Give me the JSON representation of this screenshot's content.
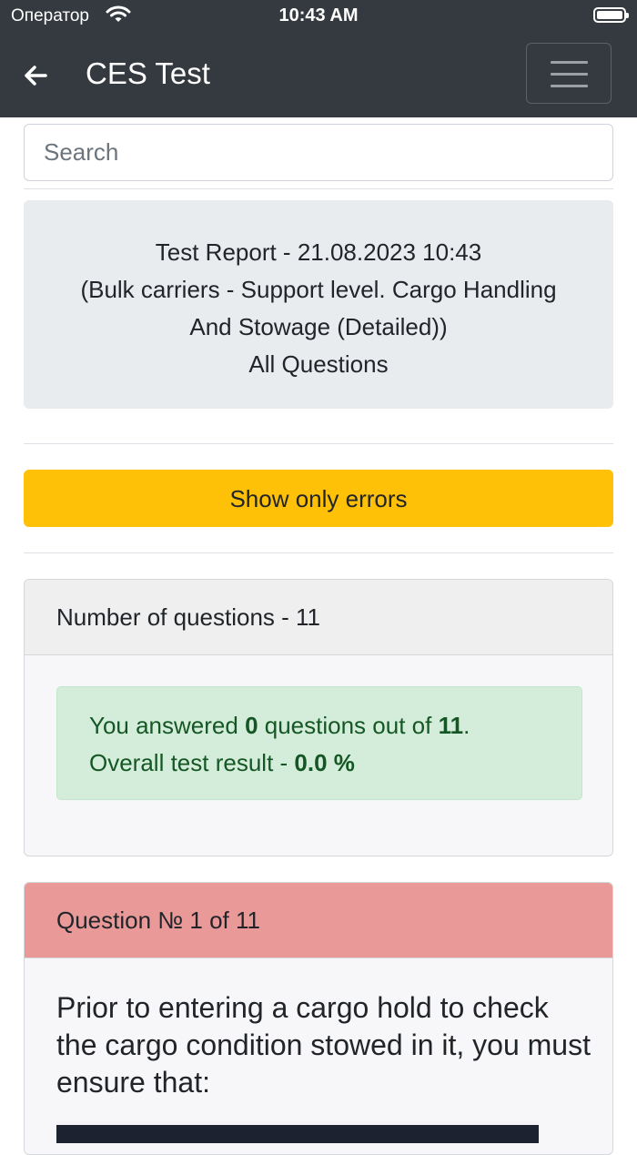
{
  "status_bar": {
    "carrier": "Оператор",
    "time": "10:43 AM"
  },
  "navbar": {
    "title": "CES Test"
  },
  "search": {
    "placeholder": "Search"
  },
  "report": {
    "line1": "Test Report - 21.08.2023 10:43",
    "line2": "(Bulk carriers - Support level. Cargo Handling",
    "line3": "And Stowage (Detailed))",
    "line4": "All Questions"
  },
  "show_errors_label": "Show only errors",
  "summary": {
    "header": "Number of questions - 11",
    "answered_prefix": "You answered ",
    "answered_count": "0",
    "answered_middle": " questions out of ",
    "total": "11",
    "answered_suffix": ".",
    "result_prefix": "Overall test result - ",
    "result_value": "0.0 %"
  },
  "question": {
    "header": "Question № 1 of 11",
    "text": "Prior to entering a cargo hold to check the cargo condition stowed in it, you must ensure that:"
  }
}
